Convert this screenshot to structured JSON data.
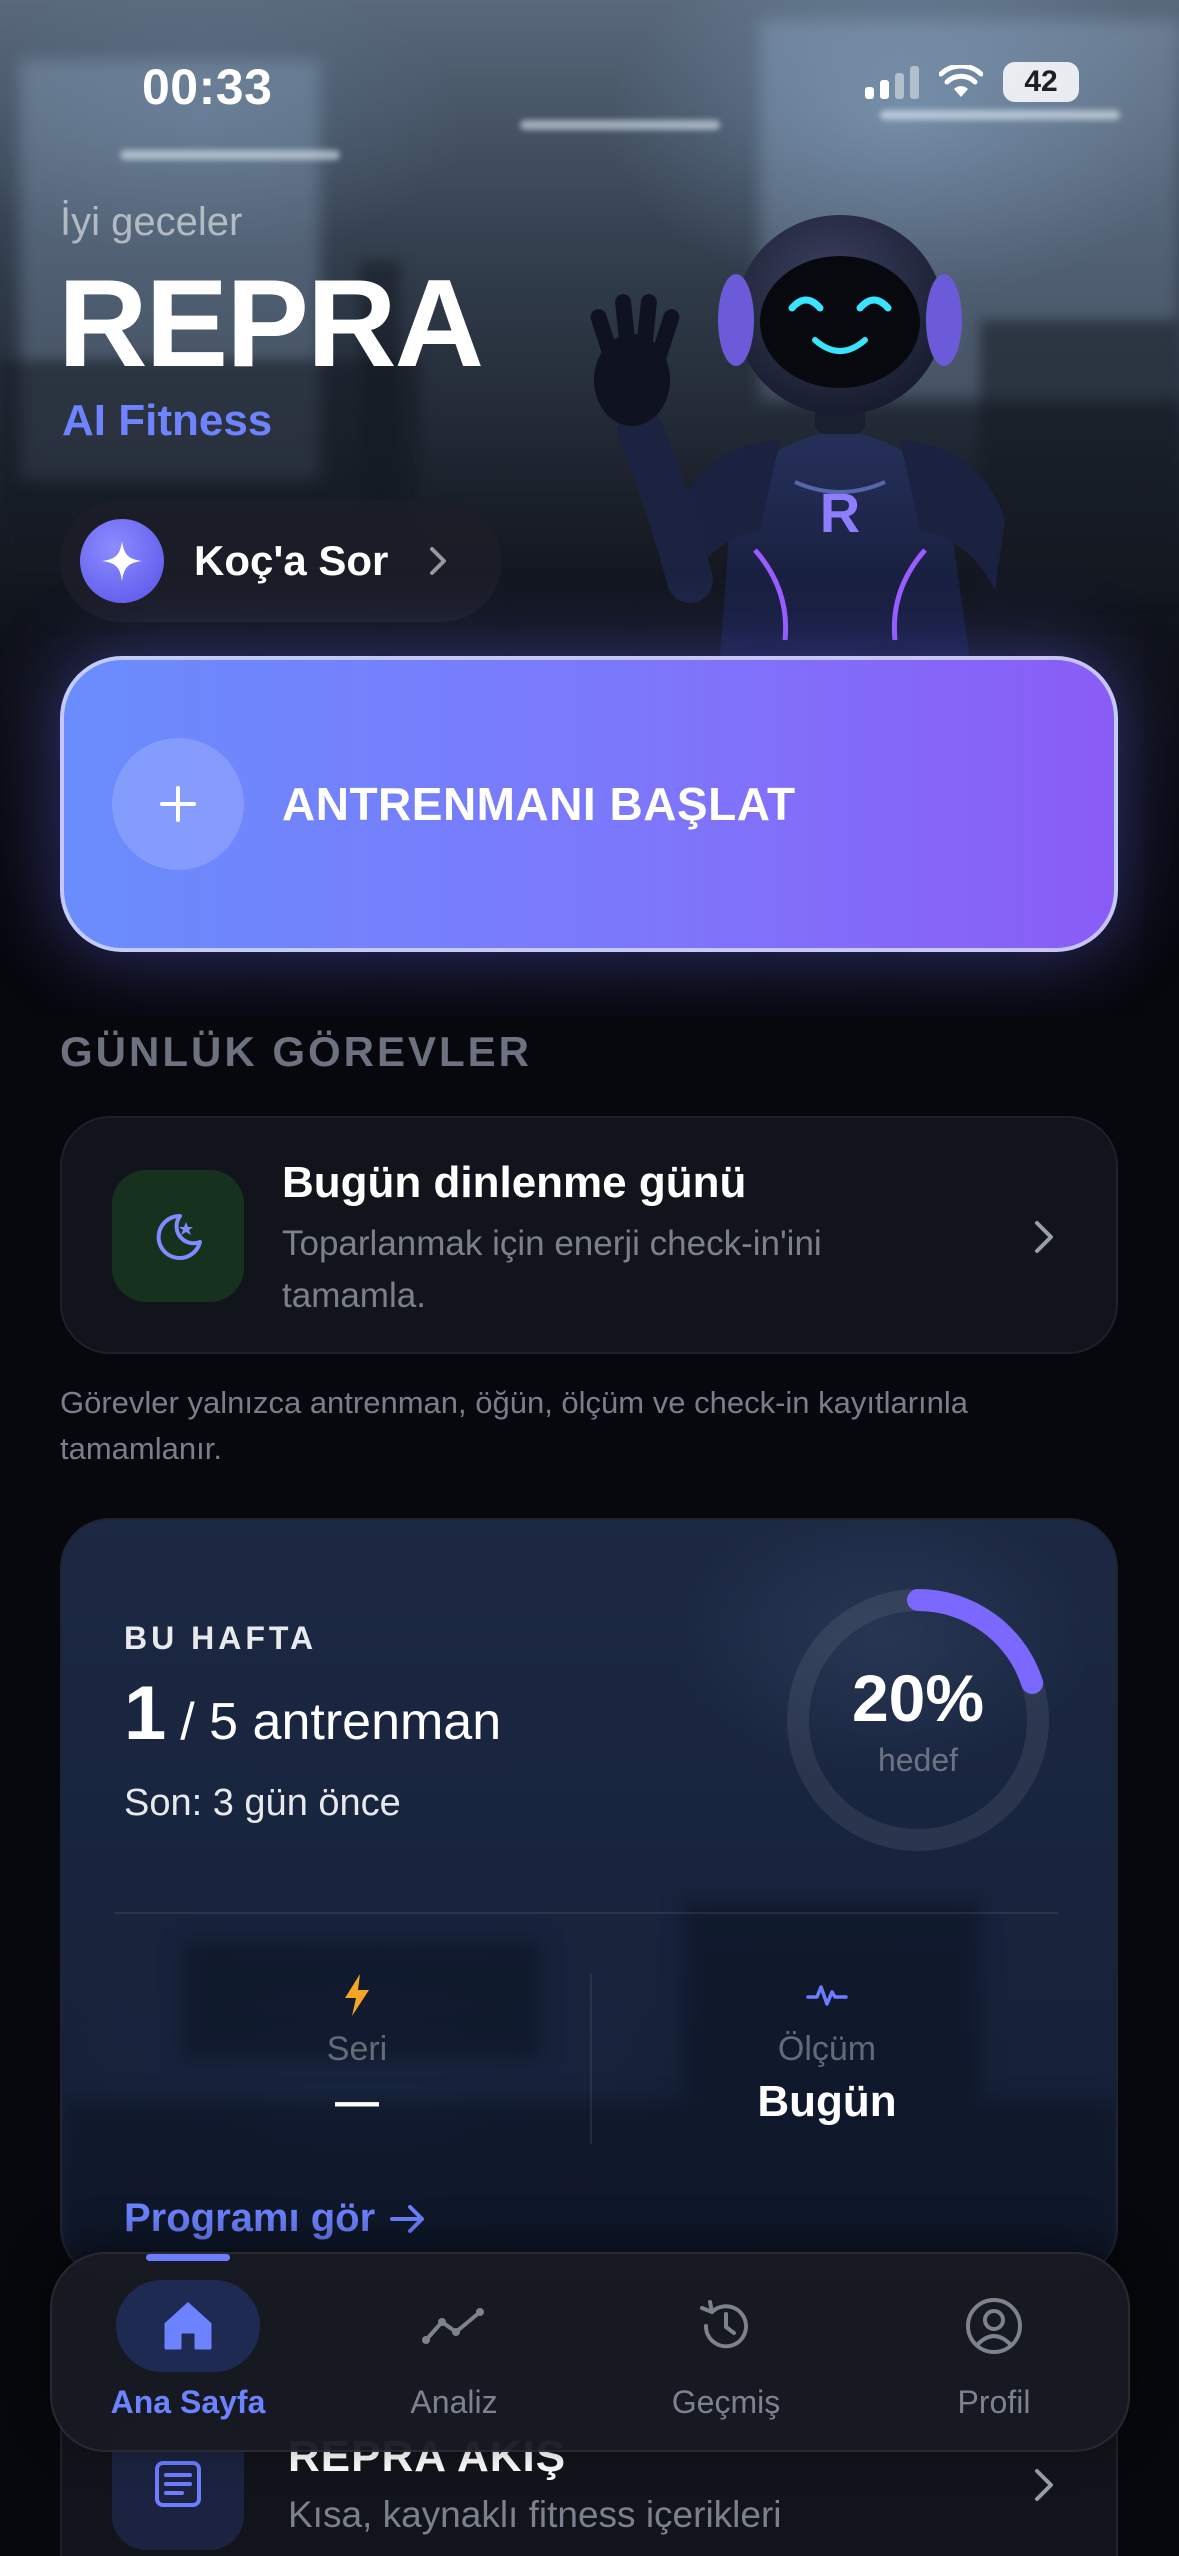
{
  "status_bar": {
    "time": "00:33",
    "battery": "42"
  },
  "header": {
    "greeting": "İyi geceler",
    "brand": "REPRA",
    "brand_subtitle": "AI Fitness",
    "ask_coach_label": "Koç'a Sor"
  },
  "start_workout": {
    "label": "ANTRENMANI BAŞLAT"
  },
  "daily_tasks": {
    "section_title": "GÜNLÜK GÖREVLER",
    "task": {
      "title": "Bugün dinlenme günü",
      "description": "Toparlanmak için enerji check-in'ini tamamla."
    },
    "note": "Görevler yalnızca antrenman, öğün, ölçüm ve check-in kayıtlarınla tamamlanır."
  },
  "weekly": {
    "label": "BU HAFTA",
    "completed": "1",
    "target_text": "/ 5 antrenman",
    "last_workout": "Son: 3 gün önce",
    "progress_percent_label": "20%",
    "progress_fraction": 0.2,
    "progress_caption": "hedef",
    "stats": [
      {
        "name": "Seri",
        "value": "—",
        "icon": "bolt-icon"
      },
      {
        "name": "Ölçüm",
        "value": "Bugün",
        "icon": "pulse-icon"
      }
    ],
    "program_link": "Programı gör"
  },
  "feed": {
    "title": "REPRA AKIŞ",
    "description": "Kısa, kaynaklı fitness içerikleri"
  },
  "tab_bar": {
    "tabs": [
      {
        "label": "Ana Sayfa",
        "icon": "home-icon",
        "active": true
      },
      {
        "label": "Analiz",
        "icon": "trend-icon",
        "active": false
      },
      {
        "label": "Geçmiş",
        "icon": "history-icon",
        "active": false
      },
      {
        "label": "Profil",
        "icon": "profile-icon",
        "active": false
      }
    ]
  },
  "colors": {
    "accent": "#6D82FF",
    "start_gradient_from": "#6A8DFC",
    "start_gradient_to": "#8A5CF6",
    "streak_bolt": "#F5A524",
    "rest_icon_bg": "#16321F"
  }
}
